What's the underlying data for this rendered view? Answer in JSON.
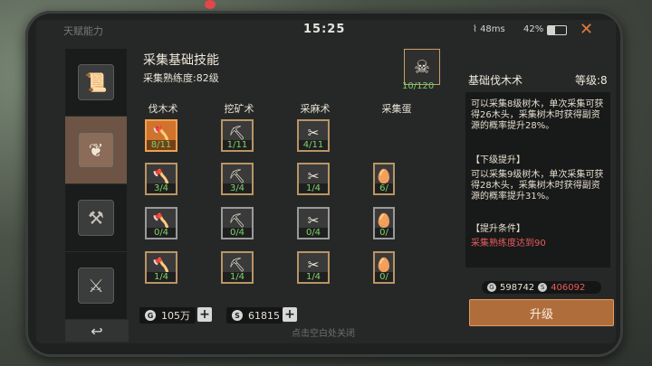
{
  "status": {
    "title": "天赋能力",
    "clock": "15:25",
    "net": "48ms",
    "battery": "42%",
    "battery_level": 0.42
  },
  "skill": {
    "title": "采集基础技能",
    "proficiency": "采集熟练度:82级",
    "badge_count": "10/120"
  },
  "columns": [
    "伐木术",
    "挖矿术",
    "采麻术",
    "采集蛋"
  ],
  "grid": [
    [
      {
        "lv": "8/11",
        "sel": true
      },
      {
        "lv": "1/11"
      },
      {
        "lv": "4/11"
      }
    ],
    [
      {
        "lv": "3/4"
      },
      {
        "lv": "3/4"
      },
      {
        "lv": "1/4"
      },
      {
        "lv": "6/"
      }
    ],
    [
      {
        "lv": "0/4",
        "gray": true
      },
      {
        "lv": "0/4",
        "gray": true
      },
      {
        "lv": "0/4",
        "gray": true
      },
      {
        "lv": "0/",
        "gray": true
      }
    ],
    [
      {
        "lv": "1/4"
      },
      {
        "lv": "1/4"
      },
      {
        "lv": "1/4"
      },
      {
        "lv": "0/"
      }
    ]
  ],
  "resources": {
    "coin": "105万",
    "silver": "61815"
  },
  "detail": {
    "title": "基础伐木术",
    "level": "等级:8",
    "current": "可以采集8级树木，单次采集可获得26木头，采集树木时获得副资源的概率提升28%。",
    "next_header": "【下级提升】",
    "next": "可以采集9级树木，单次采集可获得28木头，采集树木时获得副资源的概率提升31%。",
    "cond_header": "【提升条件】",
    "cond": "采集熟练度达到90",
    "own_coin": "598742",
    "own_silver": "406092",
    "upgrade": "升级"
  },
  "hint": "点击空白处关闭"
}
